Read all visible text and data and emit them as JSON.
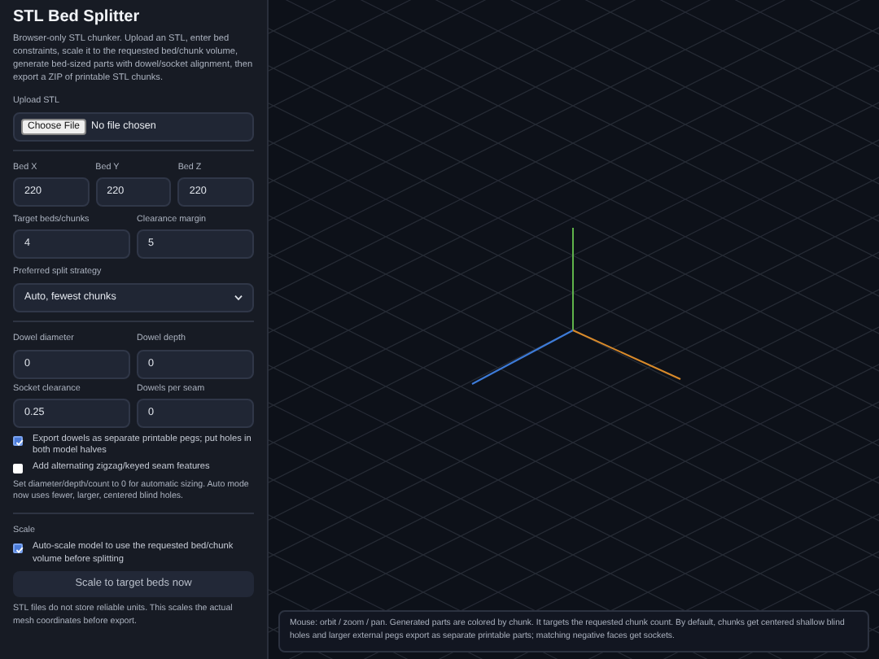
{
  "sidebar": {
    "title": "STL Bed Splitter",
    "description": "Browser-only STL chunker. Upload an STL, enter bed constraints, scale it to the requested bed/chunk volume, generate bed-sized parts with dowel/socket alignment, then export a ZIP of printable STL chunks.",
    "upload": {
      "label": "Upload STL",
      "button": "Choose File",
      "status": "No file chosen"
    },
    "bed_fields": [
      {
        "label": "Bed X",
        "value": "220"
      },
      {
        "label": "Bed Y",
        "value": "220"
      },
      {
        "label": "Bed Z",
        "value": "220"
      }
    ],
    "target_fields": [
      {
        "label": "Target beds/chunks",
        "value": "4"
      },
      {
        "label": "Clearance margin",
        "value": "5"
      }
    ],
    "strategy": {
      "label": "Preferred split strategy",
      "value": "Auto, fewest chunks"
    },
    "dowel_fields": [
      {
        "label": "Dowel diameter",
        "value": "0"
      },
      {
        "label": "Dowel depth",
        "value": "0"
      },
      {
        "label": "Socket clearance",
        "value": "0.25"
      },
      {
        "label": "Dowels per seam",
        "value": "0"
      }
    ],
    "dowel_options": [
      {
        "label": "Export dowels as separate printable pegs; put holes in both model halves",
        "checked": true
      },
      {
        "label": "Add alternating zigzag/keyed seam features",
        "checked": false
      }
    ],
    "dowel_note": "Set diameter/depth/count to 0 for automatic sizing. Auto mode now uses fewer, larger, centered blind holes.",
    "scale": {
      "label": "Scale",
      "option": {
        "label": "Auto-scale model to use the requested bed/chunk volume before splitting",
        "checked": true
      },
      "button": "Scale to target beds now",
      "note": "STL files do not store reliable units. This scales the actual mesh coordinates before export."
    }
  },
  "viewport": {
    "hint": "Mouse: orbit / zoom / pan. Generated parts are colored by chunk. It targets the requested chunk count. By default, chunks get centered shallow blind holes and larger external pegs export as separate printable parts; matching negative faces get sockets."
  }
}
